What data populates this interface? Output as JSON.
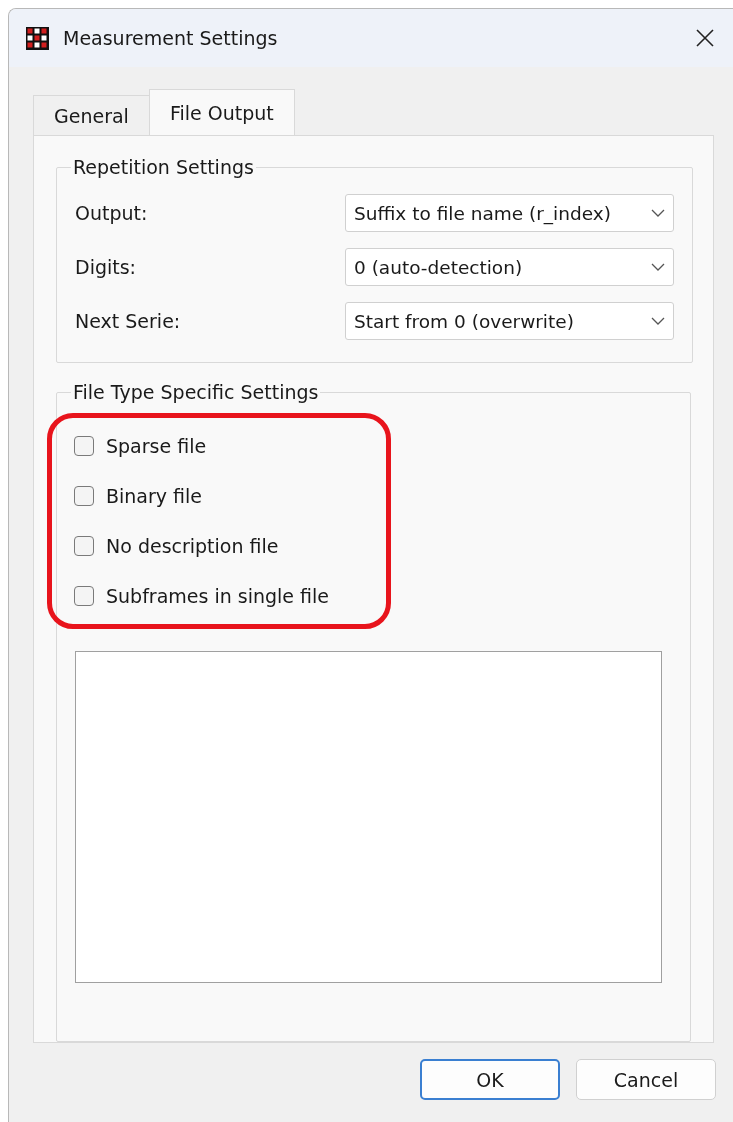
{
  "window": {
    "title": "Measurement Settings"
  },
  "tabs": [
    {
      "label": "General",
      "selected": false
    },
    {
      "label": "File Output",
      "selected": true
    }
  ],
  "repetition_settings": {
    "title": "Repetition Settings",
    "rows": [
      {
        "label": "Output:",
        "value": "Suffix to file name (r_index)"
      },
      {
        "label": "Digits:",
        "value": "0 (auto-detection)"
      },
      {
        "label": "Next Serie:",
        "value": "Start from 0 (overwrite)"
      }
    ]
  },
  "file_type_settings": {
    "title": "File Type Specific Settings",
    "highlighted": true,
    "options": [
      {
        "label": "Sparse file",
        "checked": false
      },
      {
        "label": "Binary file",
        "checked": false
      },
      {
        "label": "No description file",
        "checked": false
      },
      {
        "label": "Subframes in single file",
        "checked": false
      }
    ]
  },
  "buttons": [
    {
      "label": "OK",
      "default": true
    },
    {
      "label": "Cancel",
      "default": false
    }
  ]
}
